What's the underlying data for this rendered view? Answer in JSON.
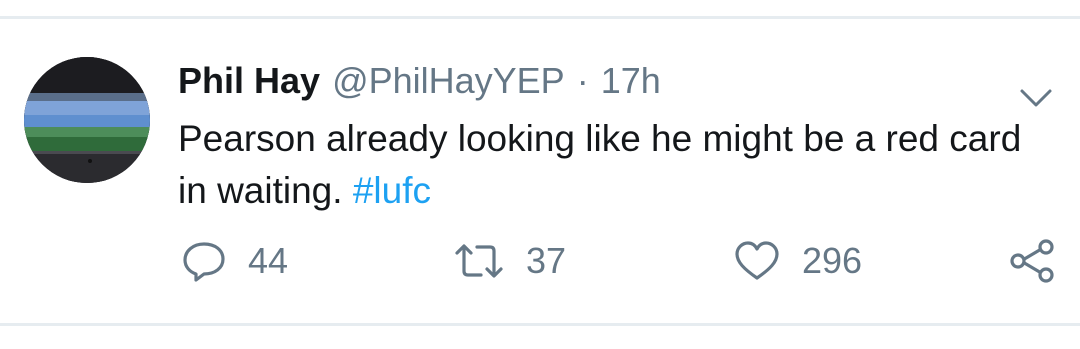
{
  "tweet": {
    "author_name": "Phil Hay",
    "handle": "@PhilHayYEP",
    "separator": "·",
    "time": "17h",
    "text": "Pearson already looking like he might be a red card in waiting.",
    "hashtag": "#lufc",
    "avatar_icon": "stadium-photo-avatar",
    "more_icon": "chevron-down-icon"
  },
  "actions": {
    "reply_count": "44",
    "retweet_count": "37",
    "like_count": "296",
    "share_icon": "share-icon"
  },
  "colors": {
    "text": "#14171a",
    "secondary": "#657786",
    "link": "#1da1f2",
    "divider": "#e6ecf0"
  }
}
